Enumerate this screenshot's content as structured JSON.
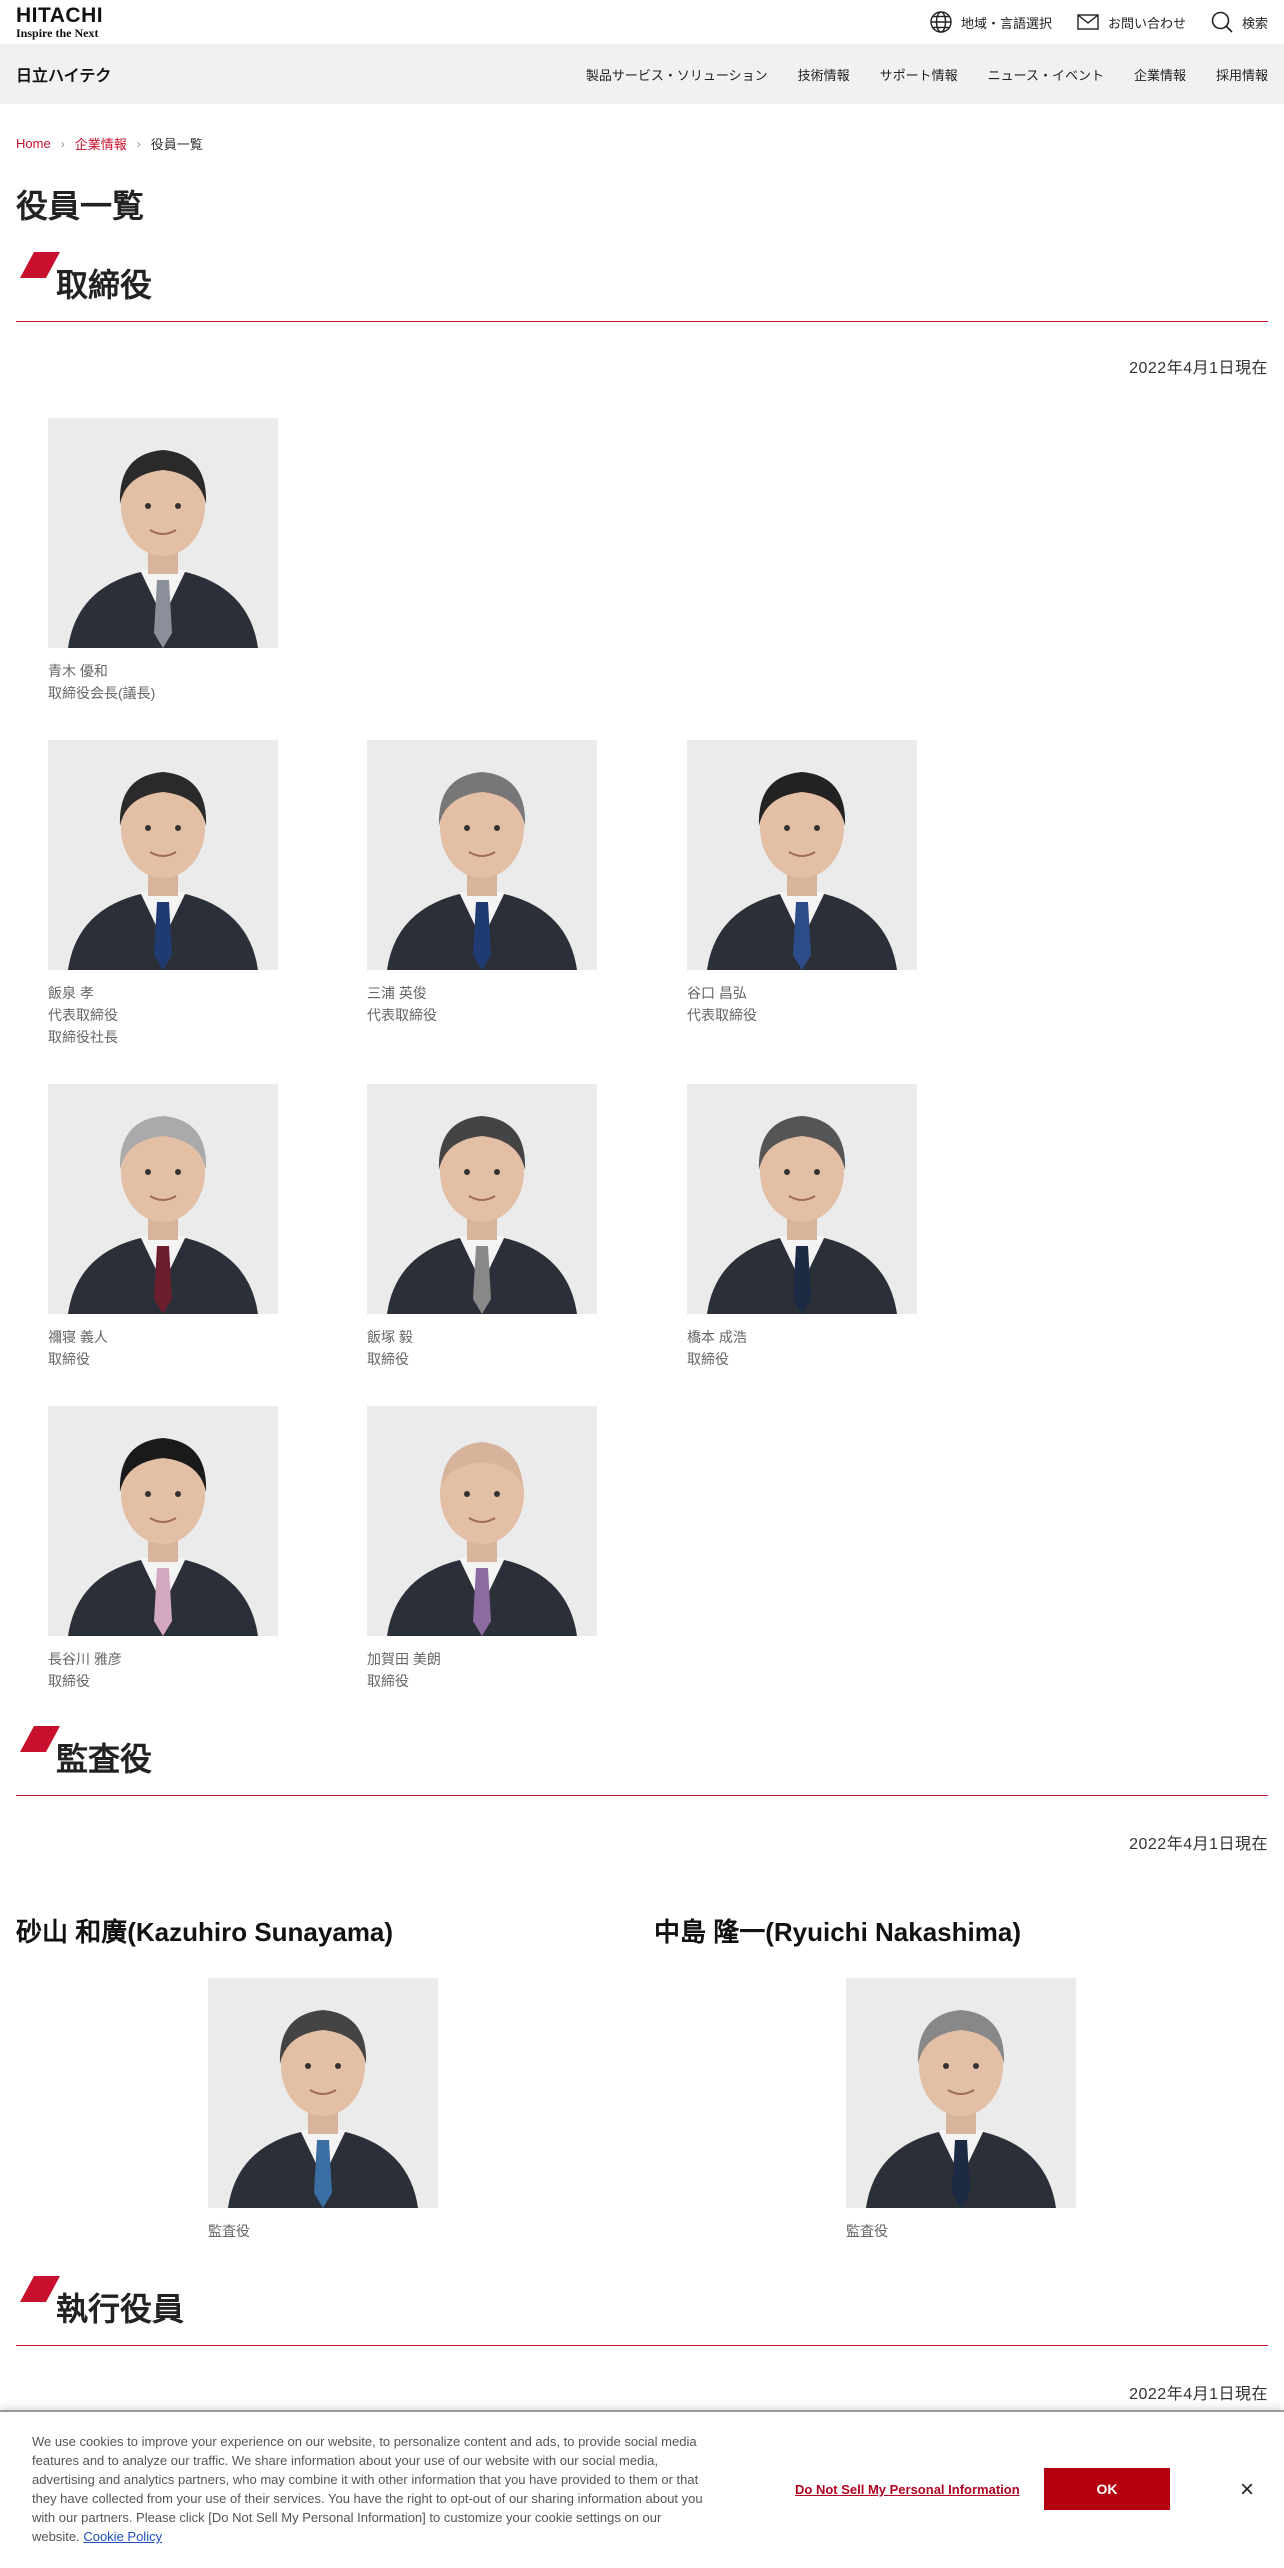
{
  "header": {
    "logo_main": "HITACHI",
    "logo_sub": "Inspire the Next",
    "util_links": [
      {
        "label": "地域・言語選択",
        "icon": "globe-icon"
      },
      {
        "label": "お問い合わせ",
        "icon": "mail-icon"
      },
      {
        "label": "検索",
        "icon": "search-icon"
      }
    ]
  },
  "nav": {
    "brand": "日立ハイテク",
    "items": [
      "製品サービス・ソリューション",
      "技術情報",
      "サポート情報",
      "ニュース・イベント",
      "企業情報",
      "採用情報"
    ]
  },
  "breadcrumb": {
    "home": "Home",
    "parent": "企業情報",
    "current": "役員一覧"
  },
  "page_title": "役員一覧",
  "colors": {
    "accent": "#c8102e",
    "ok_button": "#b50010"
  },
  "sections": {
    "directors": {
      "title": "取締役",
      "as_of": "2022年4月1日現在",
      "people": [
        {
          "name": "青木 優和",
          "roles": [
            "取締役会長(議長)"
          ]
        },
        {
          "name": "飯泉 孝",
          "roles": [
            "代表取締役",
            "取締役社長"
          ]
        },
        {
          "name": "三浦 英俊",
          "roles": [
            "代表取締役"
          ]
        },
        {
          "name": "谷口 昌弘",
          "roles": [
            "代表取締役"
          ]
        },
        {
          "name": "禰寝 義人",
          "roles": [
            "取締役"
          ]
        },
        {
          "name": "飯塚 毅",
          "roles": [
            "取締役"
          ]
        },
        {
          "name": "橋本 成浩",
          "roles": [
            "取締役"
          ]
        },
        {
          "name": "長谷川 雅彦",
          "roles": [
            "取締役"
          ]
        },
        {
          "name": "加賀田 美朗",
          "roles": [
            "取締役"
          ]
        }
      ]
    },
    "auditors": {
      "title": "監査役",
      "as_of": "2022年4月1日現在",
      "people": [
        {
          "name": "砂山 和廣(Kazuhiro Sunayama)",
          "role": "監査役"
        },
        {
          "name": "中島 隆一(Ryuichi Nakashima)",
          "role": "監査役"
        }
      ]
    },
    "officers": {
      "title": "執行役員",
      "as_of": "2022年4月1日現在"
    }
  },
  "cookie": {
    "text": "We use cookies to improve your experience on our website, to personalize content and ads, to provide social media features and to analyze our traffic. We share information about your use of our website with our social media, advertising and analytics partners, who may combine it with other information that you have provided to them or that they have collected from your use of their services. You have the right to opt-out of our sharing information about you with our partners. Please click [Do Not Sell My Personal Information] to customize your cookie settings on our website.",
    "policy_link": "Cookie Policy",
    "dns_label": "Do Not Sell My Personal Information",
    "ok_label": "OK",
    "close_label": "×"
  }
}
